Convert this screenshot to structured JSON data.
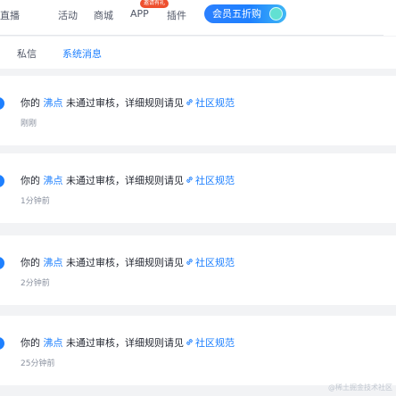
{
  "nav": {
    "items": [
      "直播",
      "活动",
      "商城"
    ],
    "app_label": "APP",
    "app_badge": "邀请有礼",
    "plugin_label": "插件",
    "vip_label": "会员五折购"
  },
  "tabs": [
    {
      "label": "私信",
      "active": false
    },
    {
      "label": "系统消息",
      "active": true
    }
  ],
  "messages": [
    {
      "prefix": "你的",
      "target": "沸点",
      "middle": "未通过审核，详细规则请见",
      "link": "社区规范",
      "time": "刚刚"
    },
    {
      "prefix": "你的",
      "target": "沸点",
      "middle": "未通过审核，详细规则请见",
      "link": "社区规范",
      "time": "1分钟前"
    },
    {
      "prefix": "你的",
      "target": "沸点",
      "middle": "未通过审核，详细规则请见",
      "link": "社区规范",
      "time": "2分钟前"
    },
    {
      "prefix": "你的",
      "target": "沸点",
      "middle": "未通过审核，详细规则请见",
      "link": "社区规范",
      "time": "25分钟前"
    }
  ],
  "watermark": "@稀土掘金技术社区",
  "colors": {
    "accent": "#1e80ff",
    "badge": "#ee502f",
    "time": "#8a919f"
  }
}
